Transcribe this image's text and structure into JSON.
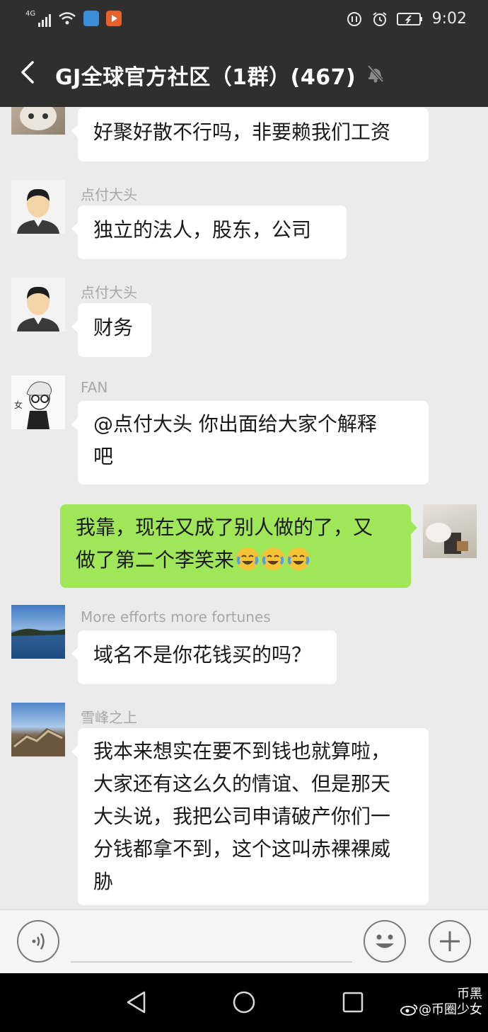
{
  "status_bar": {
    "network": "4G",
    "time": "9:02"
  },
  "header": {
    "title": "GJ全球官方社区（1群）(467)"
  },
  "messages": [
    {
      "sender": "",
      "text": "好聚好散不行吗，非要赖我们工资"
    },
    {
      "sender": "点付大头",
      "text": "独立的法人，股东，公司"
    },
    {
      "sender": "点付大头",
      "text": "财务"
    },
    {
      "sender": "FAN",
      "text_lines": [
        "@点付大头  你出面给大家个解释",
        "吧"
      ]
    },
    {
      "sender": "self",
      "text_lines": [
        "我靠，现在又成了别人做的了，又",
        "做了第二个李笑来"
      ],
      "emoji": [
        "face-with-tears-of-joy-icon",
        "face-with-tears-of-joy-icon",
        "face-with-tears-of-joy-icon"
      ]
    },
    {
      "sender": "More efforts  more fortunes",
      "text": "域名不是你花钱买的吗？"
    },
    {
      "sender": "雪峰之上",
      "text_lines": [
        "我本来想实在要不到钱也就算啦，",
        "大家还有这么久的情谊、但是那天",
        "大头说，我把公司申请破产你们一",
        "分钱都拿不到，这个这叫赤裸裸威",
        "胁"
      ]
    }
  ],
  "watermark": {
    "line1": "币黑",
    "line2": "@币圈少女"
  },
  "colors": {
    "bar": "#2f2f2f",
    "chat_bg": "#ebebeb",
    "self_bubble": "#9fe658"
  }
}
